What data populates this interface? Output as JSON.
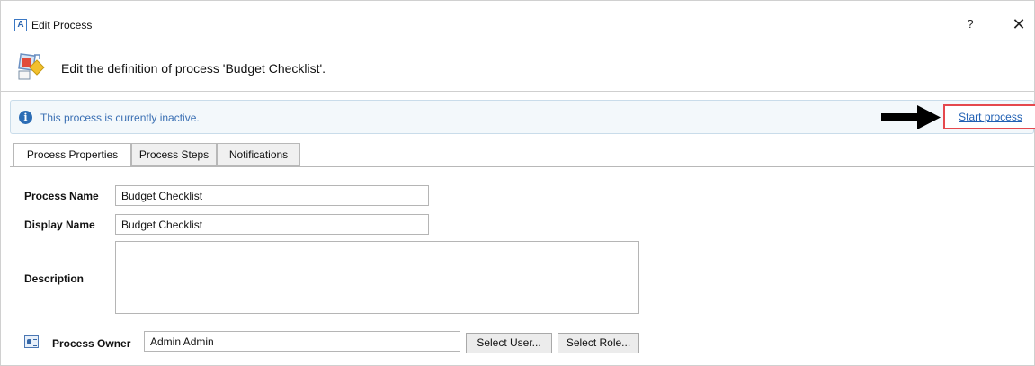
{
  "window": {
    "app_icon_letter": "A",
    "title": "Edit Process",
    "help_label": "?",
    "close_label": "✕"
  },
  "header": {
    "text": "Edit the definition of process 'Budget Checklist'."
  },
  "infobar": {
    "icon_glyph": "i",
    "message": "This process is currently inactive.",
    "link_label": "Start process"
  },
  "tabs": [
    {
      "label": "Process Properties",
      "active": true
    },
    {
      "label": "Process Steps",
      "active": false
    },
    {
      "label": "Notifications",
      "active": false
    }
  ],
  "form": {
    "process_name_label": "Process Name",
    "process_name_value": "Budget Checklist",
    "display_name_label": "Display Name",
    "display_name_value": "Budget Checklist",
    "description_label": "Description",
    "description_value": "",
    "process_owner_label": "Process Owner",
    "process_owner_value": "Admin Admin",
    "select_user_label": "Select User...",
    "select_role_label": "Select Role..."
  },
  "icons": {
    "app": "app-logo-icon",
    "header": "process-diagram-icon",
    "info": "info-icon",
    "arrow": "arrow-right-icon",
    "owner": "contact-card-icon"
  }
}
